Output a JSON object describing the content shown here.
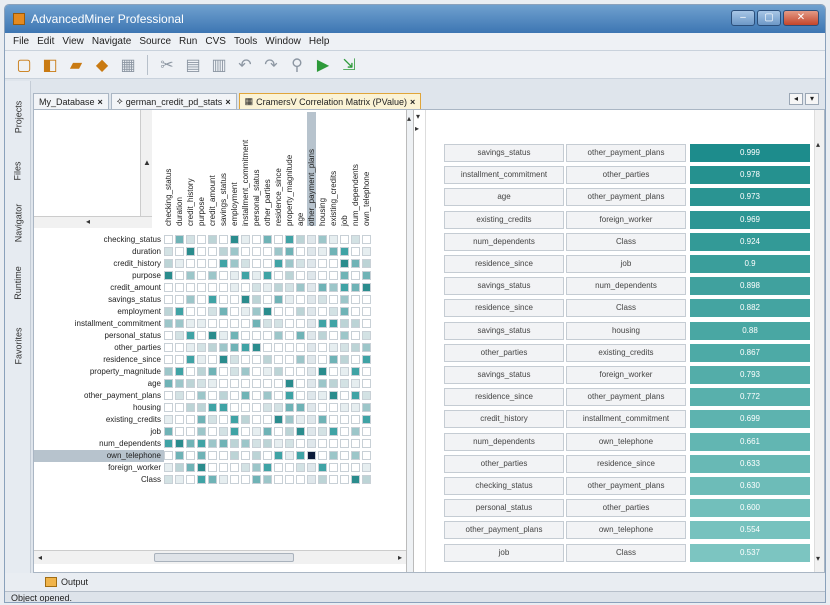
{
  "window": {
    "title": "AdvancedMiner Professional",
    "min": "–",
    "max": "▢",
    "close": "✕"
  },
  "menu": [
    "File",
    "Edit",
    "View",
    "Navigate",
    "Source",
    "Run",
    "CVS",
    "Tools",
    "Window",
    "Help"
  ],
  "sidebar_tabs": [
    "Projects",
    "Files",
    "Navigator",
    "Runtime",
    "Favorites"
  ],
  "tabs": [
    {
      "label": "My_Database"
    },
    {
      "label": "german_credit_pd_stats"
    },
    {
      "label": "CramersV Correlation Matrix (PValue)"
    }
  ],
  "columns": [
    "checking_status",
    "duration",
    "credit_history",
    "purpose",
    "credit_amount",
    "savings_status",
    "employment",
    "installment_commitment",
    "personal_status",
    "other_parties",
    "residence_since",
    "property_magnitude",
    "age",
    "other_payment_plans",
    "housing",
    "existing_credits",
    "job",
    "num_dependents",
    "own_telephone"
  ],
  "rows": [
    "checking_status",
    "duration",
    "credit_history",
    "purpose",
    "credit_amount",
    "savings_status",
    "employment",
    "installment_commitment",
    "personal_status",
    "other_parties",
    "residence_since",
    "property_magnitude",
    "age",
    "other_payment_plans",
    "housing",
    "existing_credits",
    "job",
    "num_dependents",
    "own_telephone",
    "foreign_worker",
    "Class"
  ],
  "selected_column": "other_payment_plans",
  "selected_row": "own_telephone",
  "pairs": [
    {
      "a": "savings_status",
      "b": "other_payment_plans",
      "v": "0.999"
    },
    {
      "a": "installment_commitment",
      "b": "other_parties",
      "v": "0.978"
    },
    {
      "a": "age",
      "b": "other_payment_plans",
      "v": "0.973"
    },
    {
      "a": "existing_credits",
      "b": "foreign_worker",
      "v": "0.969"
    },
    {
      "a": "num_dependents",
      "b": "Class",
      "v": "0.924"
    },
    {
      "a": "residence_since",
      "b": "job",
      "v": "0.9"
    },
    {
      "a": "savings_status",
      "b": "num_dependents",
      "v": "0.898"
    },
    {
      "a": "residence_since",
      "b": "Class",
      "v": "0.882"
    },
    {
      "a": "savings_status",
      "b": "housing",
      "v": "0.88"
    },
    {
      "a": "other_parties",
      "b": "existing_credits",
      "v": "0.867"
    },
    {
      "a": "savings_status",
      "b": "foreign_worker",
      "v": "0.793"
    },
    {
      "a": "residence_since",
      "b": "other_payment_plans",
      "v": "0.772"
    },
    {
      "a": "credit_history",
      "b": "installment_commitment",
      "v": "0.699"
    },
    {
      "a": "num_dependents",
      "b": "own_telephone",
      "v": "0.661"
    },
    {
      "a": "other_parties",
      "b": "residence_since",
      "v": "0.633"
    },
    {
      "a": "checking_status",
      "b": "other_payment_plans",
      "v": "0.630"
    },
    {
      "a": "personal_status",
      "b": "other_parties",
      "v": "0.600"
    },
    {
      "a": "other_payment_plans",
      "b": "own_telephone",
      "v": "0.554"
    },
    {
      "a": "job",
      "b": "Class",
      "v": "0.537"
    }
  ],
  "output_label": "Output",
  "status": "Object opened."
}
